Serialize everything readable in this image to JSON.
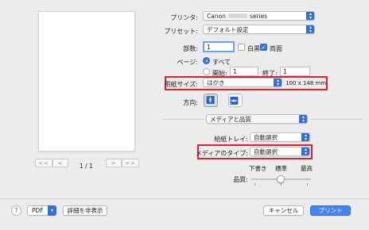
{
  "preview": {
    "first_label": "<<",
    "prev_label": "<",
    "page_indicator": "1 / 1",
    "next_label": ">",
    "last_label": ">>"
  },
  "printer": {
    "label": "プリンタ:",
    "value_prefix": "Canon",
    "value_suffix": "series"
  },
  "preset": {
    "label": "プリセット:",
    "value": "デフォルト設定"
  },
  "copies": {
    "label": "部数:",
    "value": "1",
    "bw_label": "白黒",
    "duplex_label": "両面"
  },
  "pages": {
    "label": "ページ:",
    "all_label": "すべて",
    "range_label": "開始:",
    "from_value": "1",
    "to_label": "終了:",
    "to_value": "1"
  },
  "paper_size": {
    "label": "用紙サイズ:",
    "value": "はがき",
    "dimensions": "100 x 148 mm"
  },
  "orientation": {
    "label": "方向:"
  },
  "section": {
    "value": "メディアと品質"
  },
  "feed": {
    "label": "給紙トレイ:",
    "value": "自動選択"
  },
  "media_type": {
    "label": "メディアのタイプ:",
    "value": "自動選択"
  },
  "quality": {
    "label": "品質:",
    "draft_label": "下書き",
    "standard_label": "標準",
    "best_label": "最高",
    "level": "standard"
  },
  "footer": {
    "help_label": "?",
    "pdf_label": "PDF",
    "details_label": "詳細を非表示",
    "cancel_label": "キャンセル",
    "print_label": "プリント"
  },
  "colors": {
    "accent": "#3d86f4",
    "highlight": "#e0202a"
  }
}
